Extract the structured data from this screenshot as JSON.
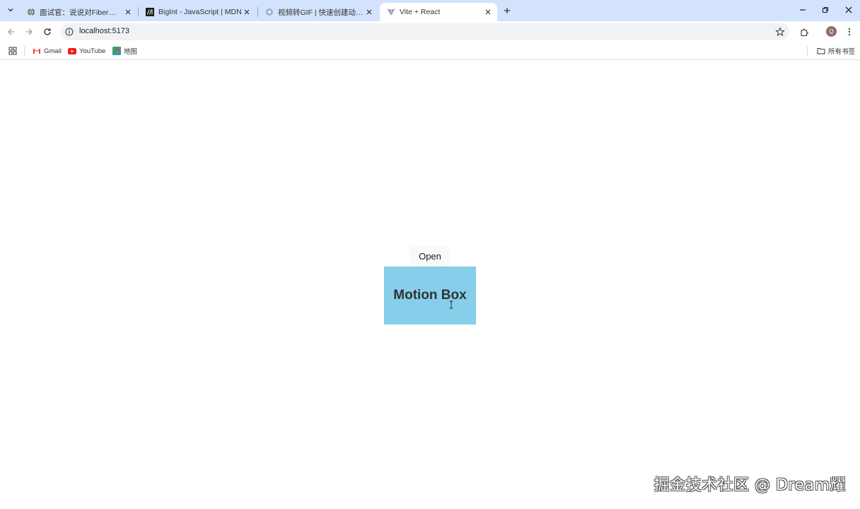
{
  "browser": {
    "tabs": [
      {
        "title": "面试官：说说对Fiber架构的理…",
        "icon": "globe-icon",
        "active": false
      },
      {
        "title": "BigInt - JavaScript | MDN",
        "icon": "mdn-icon",
        "active": false
      },
      {
        "title": "视频转GIF | 快速创建动态表情…",
        "icon": "gif-site-icon",
        "active": false
      },
      {
        "title": "Vite + React",
        "icon": "vite-icon",
        "active": true
      }
    ],
    "url": "localhost:5173",
    "profile_initial": "Q",
    "bookmarks": [
      {
        "label": "Gmail",
        "icon": "gmail-icon"
      },
      {
        "label": "YouTube",
        "icon": "youtube-icon"
      },
      {
        "label": "地图",
        "icon": "maps-icon"
      }
    ],
    "all_bookmarks_label": "所有书签"
  },
  "page": {
    "open_button_label": "Open",
    "motion_box_title": "Motion Box",
    "motion_box_color": "#87ceeb"
  },
  "watermark": "掘金技术社区 @ Dream耀"
}
